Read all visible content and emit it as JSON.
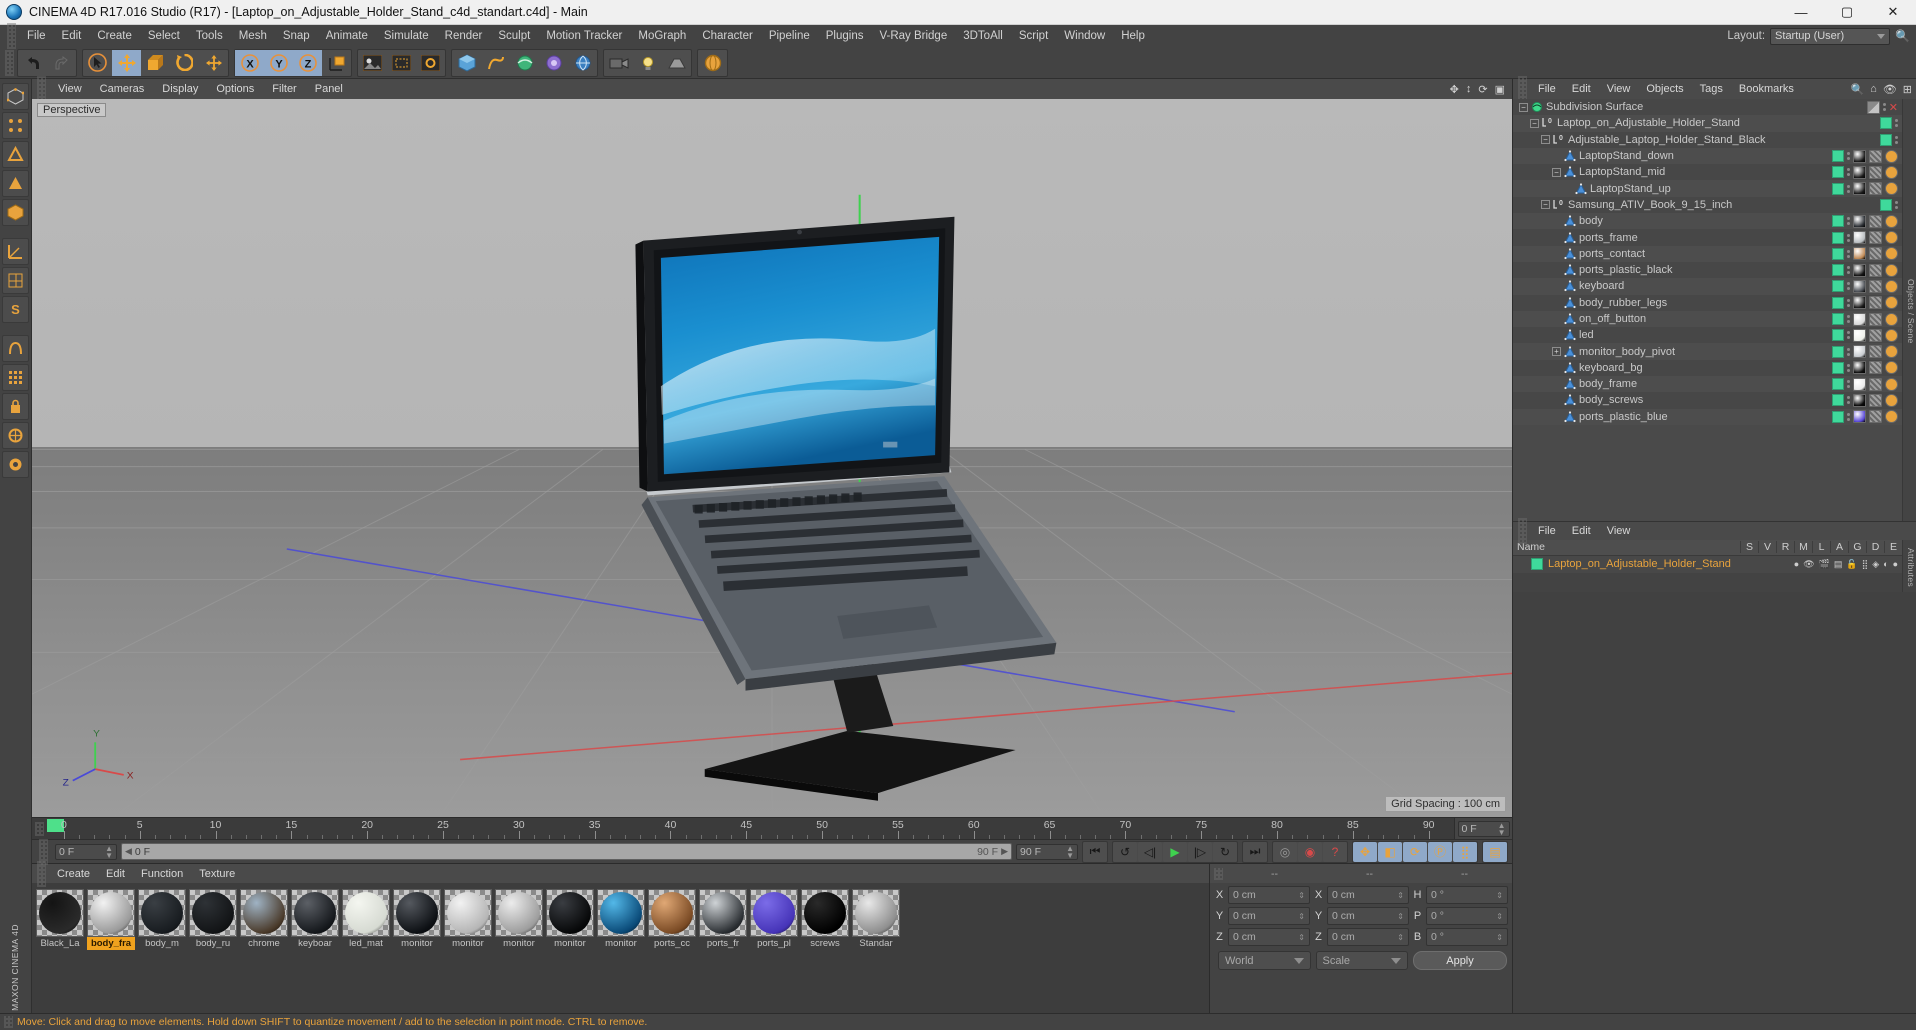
{
  "window": {
    "title": "CINEMA 4D R17.016 Studio (R17) - [Laptop_on_Adjustable_Holder_Stand_c4d_standart.c4d] - Main",
    "minimize": "—",
    "maximize": "▢",
    "close": "✕"
  },
  "menubar": {
    "items": [
      "File",
      "Edit",
      "Create",
      "Select",
      "Tools",
      "Mesh",
      "Snap",
      "Animate",
      "Simulate",
      "Render",
      "Sculpt",
      "Motion Tracker",
      "MoGraph",
      "Character",
      "Pipeline",
      "Plugins",
      "V-Ray Bridge",
      "3DToAll",
      "Script",
      "Window",
      "Help"
    ],
    "layout_label": "Layout:",
    "layout_value": "Startup (User)"
  },
  "viewport": {
    "menu": [
      "View",
      "Cameras",
      "Display",
      "Options",
      "Filter",
      "Panel"
    ],
    "label": "Perspective",
    "grid_spacing": "Grid Spacing : 100 cm",
    "axis_x": "X",
    "axis_y": "Y",
    "axis_z": "Z"
  },
  "timeline": {
    "ticks": [
      "0",
      "5",
      "10",
      "15",
      "20",
      "25",
      "30",
      "35",
      "40",
      "45",
      "50",
      "55",
      "60",
      "65",
      "70",
      "75",
      "80",
      "85",
      "90"
    ],
    "current_frame": "0 F",
    "frame_field": "0 F",
    "preview_start": "0 F",
    "preview_end": "90 F",
    "end_frame": "90 F",
    "right_frame": "0 F"
  },
  "materials": {
    "menu": [
      "Create",
      "Edit",
      "Function",
      "Texture"
    ],
    "items": [
      {
        "name": "Black_La",
        "color1": "#141414",
        "color2": "#2a2a2a",
        "selected": false
      },
      {
        "name": "body_fra",
        "color1": "#f2f2f2",
        "color2": "#9a9a9a",
        "selected": true
      },
      {
        "name": "body_m",
        "color1": "#3a3f44",
        "color2": "#181c20",
        "selected": false
      },
      {
        "name": "body_ru",
        "color1": "#2e3236",
        "color2": "#121416",
        "selected": false
      },
      {
        "name": "chrome",
        "color1": "#9fb3c4",
        "color2": "#4a3a2a",
        "selected": false
      },
      {
        "name": "keyboar",
        "color1": "#5c6066",
        "color2": "#15181c",
        "selected": false
      },
      {
        "name": "led_mat",
        "color1": "#f4f6f0",
        "color2": "#d6dad2",
        "selected": false
      },
      {
        "name": "monitor",
        "color1": "#55595f",
        "color2": "#0d1014",
        "selected": false
      },
      {
        "name": "monitor",
        "color1": "#f2f2f2",
        "color2": "#b5b5b5",
        "selected": false
      },
      {
        "name": "monitor",
        "color1": "#ececec",
        "color2": "#9d9d9d",
        "selected": false
      },
      {
        "name": "monitor",
        "color1": "#3a3d42",
        "color2": "#070809",
        "selected": false
      },
      {
        "name": "monitor",
        "color1": "#53b8e8",
        "color2": "#0a4a78",
        "selected": false
      },
      {
        "name": "ports_cc",
        "color1": "#e0a875",
        "color2": "#7a4a24",
        "selected": false
      },
      {
        "name": "ports_fr",
        "color1": "#cfd3d6",
        "color2": "#2c3034",
        "selected": false
      },
      {
        "name": "ports_pl",
        "color1": "#7b6ce8",
        "color2": "#4634b8",
        "selected": false
      },
      {
        "name": "screws",
        "color1": "#2a2a2a",
        "color2": "#000000",
        "selected": false
      },
      {
        "name": "Standar",
        "color1": "#e8e8e8",
        "color2": "#8e8e8e",
        "selected": false
      }
    ]
  },
  "coordinates": {
    "header": [
      "--",
      "--",
      "--"
    ],
    "rows": [
      {
        "l1": "X",
        "v1": "0 cm",
        "l2": "X",
        "v2": "0 cm",
        "l3": "H",
        "v3": "0 °"
      },
      {
        "l1": "Y",
        "v1": "0 cm",
        "l2": "Y",
        "v2": "0 cm",
        "l3": "P",
        "v3": "0 °"
      },
      {
        "l1": "Z",
        "v1": "0 cm",
        "l2": "Z",
        "v2": "0 cm",
        "l3": "B",
        "v3": "0 °"
      }
    ],
    "space": "World",
    "mode": "Scale",
    "apply": "Apply"
  },
  "object_manager": {
    "menu": [
      "File",
      "Edit",
      "View",
      "Objects",
      "Tags",
      "Bookmarks"
    ],
    "sidebar_label": "Objects / Scene",
    "rows": [
      {
        "label": "Subdivision Surface",
        "depth": 0,
        "icon": "subdivision",
        "expander": "−",
        "chip": "off",
        "mat": null
      },
      {
        "label": "Laptop_on_Adjustable_Holder_Stand",
        "depth": 1,
        "icon": "null",
        "expander": "−",
        "chip": "green",
        "mat": null
      },
      {
        "label": "Adjustable_Laptop_Holder_Stand_Black",
        "depth": 2,
        "icon": "null",
        "expander": "−",
        "chip": "green",
        "mat": null
      },
      {
        "label": "LaptopStand_down",
        "depth": 3,
        "icon": "poly",
        "expander": "",
        "chip": "green",
        "mat": "#1a1a1a"
      },
      {
        "label": "LaptopStand_mid",
        "depth": 3,
        "icon": "poly",
        "expander": "−",
        "chip": "green",
        "mat": "#1a1a1a"
      },
      {
        "label": "LaptopStand_up",
        "depth": 4,
        "icon": "poly",
        "expander": "",
        "chip": "green",
        "mat": "#1a1a1a"
      },
      {
        "label": "Samsung_ATIV_Book_9_15_inch",
        "depth": 2,
        "icon": "null",
        "expander": "−",
        "chip": "green",
        "mat": null
      },
      {
        "label": "body",
        "depth": 3,
        "icon": "poly",
        "expander": "",
        "chip": "green",
        "mat": "#2a2e33"
      },
      {
        "label": "ports_frame",
        "depth": 3,
        "icon": "poly",
        "expander": "",
        "chip": "green",
        "mat": "#b9bdc0"
      },
      {
        "label": "ports_contact",
        "depth": 3,
        "icon": "poly",
        "expander": "",
        "chip": "green",
        "mat": "#c08a56"
      },
      {
        "label": "ports_plastic_black",
        "depth": 3,
        "icon": "poly",
        "expander": "",
        "chip": "green",
        "mat": "#141414"
      },
      {
        "label": "keyboard",
        "depth": 3,
        "icon": "poly",
        "expander": "",
        "chip": "green",
        "mat": "#4a4e54"
      },
      {
        "label": "body_rubber_legs",
        "depth": 3,
        "icon": "poly",
        "expander": "",
        "chip": "green",
        "mat": "#1c1c1c"
      },
      {
        "label": "on_off_button",
        "depth": 3,
        "icon": "poly",
        "expander": "",
        "chip": "green",
        "mat": "#d8d8d8"
      },
      {
        "label": "led",
        "depth": 3,
        "icon": "poly",
        "expander": "",
        "chip": "green",
        "mat": "#eef0ea"
      },
      {
        "label": "monitor_body_pivot",
        "depth": 3,
        "icon": "poly",
        "expander": "+",
        "chip": "green",
        "mat": "#c8ccd0"
      },
      {
        "label": "keyboard_bg",
        "depth": 3,
        "icon": "poly",
        "expander": "",
        "chip": "green",
        "mat": "#111111"
      },
      {
        "label": "body_frame",
        "depth": 3,
        "icon": "poly",
        "expander": "",
        "chip": "green",
        "mat": "#e8e8e8"
      },
      {
        "label": "body_screws",
        "depth": 3,
        "icon": "poly",
        "expander": "",
        "chip": "green",
        "mat": "#0a0a0a"
      },
      {
        "label": "ports_plastic_blue",
        "depth": 3,
        "icon": "poly",
        "expander": "",
        "chip": "green",
        "mat": "#5a4ad8"
      }
    ]
  },
  "layer_manager": {
    "menu": [
      "File",
      "Edit",
      "View"
    ],
    "columns": [
      "Name",
      "S",
      "V",
      "R",
      "M",
      "L",
      "A",
      "G",
      "D",
      "E"
    ],
    "sidebar_label": "Attributes",
    "row_label": "Laptop_on_Adjustable_Holder_Stand"
  },
  "statusbar": {
    "text": "Move: Click and drag to move elements. Hold down SHIFT to quantize movement / add to the selection in point mode. CTRL to remove."
  },
  "toolbar": {
    "left_rail": [
      "make-editable",
      "points-mode",
      "edges-mode",
      "polygons-mode",
      "model-mode",
      "axis-mode",
      "texture-mode",
      "workplane",
      "snap",
      "lock-axis",
      "enable-axis",
      "enable-snap"
    ],
    "maxon": "MAXON CINEMA 4D"
  },
  "colors": {
    "accent_orange": "#e8a33d",
    "selection_blue": "#8fa9c9",
    "green_chip": "#3fd99b",
    "panel_bg": "#434343",
    "viewport_top": "#b9b9b9"
  }
}
